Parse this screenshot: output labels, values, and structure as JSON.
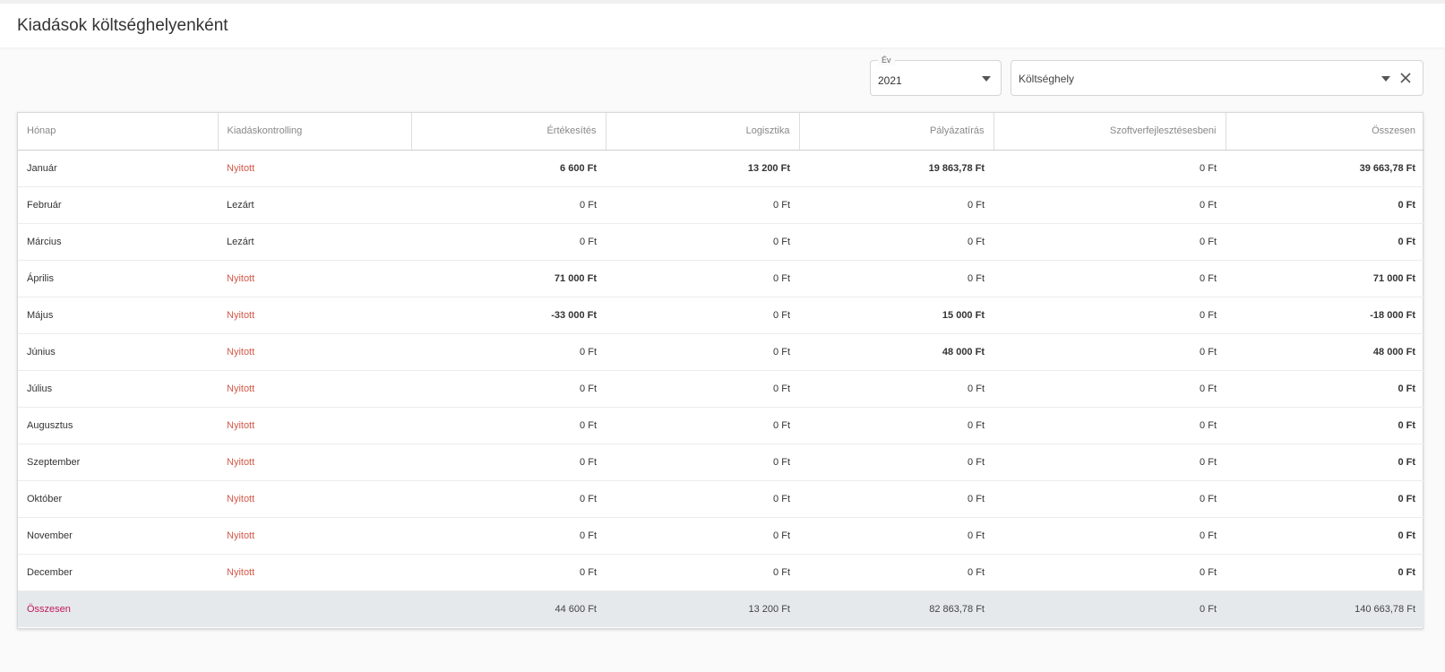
{
  "page": {
    "title": "Kiadások költséghelyenként"
  },
  "filters": {
    "year": {
      "label": "Év",
      "value": "2021"
    },
    "cost_center": {
      "placeholder": "Költséghely"
    }
  },
  "colors": {
    "status_open": "#d35a4a",
    "total_label": "#c2185b",
    "footer_bg": "#e5e9ec"
  },
  "table": {
    "columns": [
      "Hónap",
      "Kiadáskontrolling",
      "Értékesítés",
      "Logisztika",
      "Pályázatírás",
      "Szoftverfejlesztésesbeni",
      "Összesen"
    ],
    "rows": [
      {
        "month": "Január",
        "status": "Nyitott",
        "status_open": true,
        "values": [
          "6 600 Ft",
          "13 200 Ft",
          "19 863,78 Ft",
          "0 Ft",
          "39 663,78 Ft"
        ],
        "bold": [
          true,
          true,
          true,
          false,
          true
        ]
      },
      {
        "month": "Február",
        "status": "Lezárt",
        "status_open": false,
        "values": [
          "0 Ft",
          "0 Ft",
          "0 Ft",
          "0 Ft",
          "0 Ft"
        ],
        "bold": [
          false,
          false,
          false,
          false,
          true
        ]
      },
      {
        "month": "Március",
        "status": "Lezárt",
        "status_open": false,
        "values": [
          "0 Ft",
          "0 Ft",
          "0 Ft",
          "0 Ft",
          "0 Ft"
        ],
        "bold": [
          false,
          false,
          false,
          false,
          true
        ]
      },
      {
        "month": "Április",
        "status": "Nyitott",
        "status_open": true,
        "values": [
          "71 000 Ft",
          "0 Ft",
          "0 Ft",
          "0 Ft",
          "71 000 Ft"
        ],
        "bold": [
          true,
          false,
          false,
          false,
          true
        ]
      },
      {
        "month": "Május",
        "status": "Nyitott",
        "status_open": true,
        "values": [
          "-33 000 Ft",
          "0 Ft",
          "15 000 Ft",
          "0 Ft",
          "-18 000 Ft"
        ],
        "bold": [
          true,
          false,
          true,
          false,
          true
        ]
      },
      {
        "month": "Június",
        "status": "Nyitott",
        "status_open": true,
        "values": [
          "0 Ft",
          "0 Ft",
          "48 000 Ft",
          "0 Ft",
          "48 000 Ft"
        ],
        "bold": [
          false,
          false,
          true,
          false,
          true
        ]
      },
      {
        "month": "Július",
        "status": "Nyitott",
        "status_open": true,
        "values": [
          "0 Ft",
          "0 Ft",
          "0 Ft",
          "0 Ft",
          "0 Ft"
        ],
        "bold": [
          false,
          false,
          false,
          false,
          true
        ]
      },
      {
        "month": "Augusztus",
        "status": "Nyitott",
        "status_open": true,
        "values": [
          "0 Ft",
          "0 Ft",
          "0 Ft",
          "0 Ft",
          "0 Ft"
        ],
        "bold": [
          false,
          false,
          false,
          false,
          true
        ]
      },
      {
        "month": "Szeptember",
        "status": "Nyitott",
        "status_open": true,
        "values": [
          "0 Ft",
          "0 Ft",
          "0 Ft",
          "0 Ft",
          "0 Ft"
        ],
        "bold": [
          false,
          false,
          false,
          false,
          true
        ]
      },
      {
        "month": "Október",
        "status": "Nyitott",
        "status_open": true,
        "values": [
          "0 Ft",
          "0 Ft",
          "0 Ft",
          "0 Ft",
          "0 Ft"
        ],
        "bold": [
          false,
          false,
          false,
          false,
          true
        ]
      },
      {
        "month": "November",
        "status": "Nyitott",
        "status_open": true,
        "values": [
          "0 Ft",
          "0 Ft",
          "0 Ft",
          "0 Ft",
          "0 Ft"
        ],
        "bold": [
          false,
          false,
          false,
          false,
          true
        ]
      },
      {
        "month": "December",
        "status": "Nyitott",
        "status_open": true,
        "values": [
          "0 Ft",
          "0 Ft",
          "0 Ft",
          "0 Ft",
          "0 Ft"
        ],
        "bold": [
          false,
          false,
          false,
          false,
          true
        ]
      }
    ],
    "totals": {
      "label": "Összesen",
      "values": [
        "44 600 Ft",
        "13 200 Ft",
        "82 863,78 Ft",
        "0 Ft",
        "140 663,78 Ft"
      ]
    }
  }
}
